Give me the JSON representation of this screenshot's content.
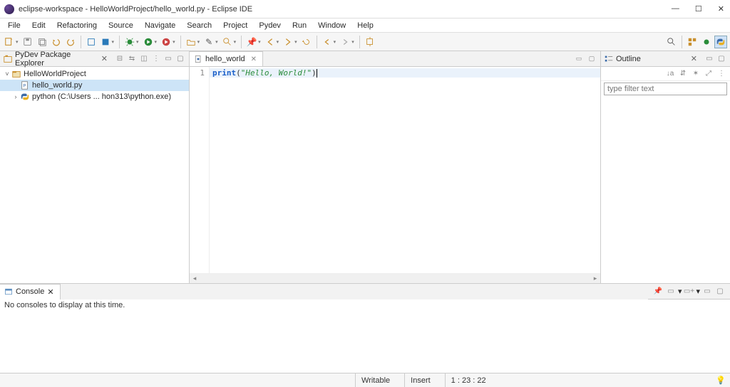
{
  "title": "eclipse-workspace - HelloWorldProject/hello_world.py - Eclipse IDE",
  "menu": [
    "File",
    "Edit",
    "Refactoring",
    "Source",
    "Navigate",
    "Search",
    "Project",
    "Pydev",
    "Run",
    "Window",
    "Help"
  ],
  "pkg_explorer": {
    "title": "PyDev Package Explorer",
    "items": [
      {
        "label": "HelloWorldProject",
        "kind": "project",
        "expanded": true,
        "depth": 0
      },
      {
        "label": "hello_world.py",
        "kind": "pyfile",
        "selected": true,
        "depth": 1
      },
      {
        "label": "python  (C:\\Users ... hon313\\python.exe)",
        "kind": "interp",
        "depth": 1,
        "expandable": true
      }
    ]
  },
  "editor": {
    "tab": "hello_world",
    "line_number": "1",
    "code": {
      "func": "print",
      "open": "(",
      "string": "\"Hello, World!\"",
      "close": ")"
    }
  },
  "outline": {
    "title": "Outline",
    "filter_placeholder": "type filter text"
  },
  "console": {
    "title": "Console",
    "message": "No consoles to display at this time."
  },
  "status": {
    "writable": "Writable",
    "insert": "Insert",
    "pos": "1 : 23 : 22"
  }
}
